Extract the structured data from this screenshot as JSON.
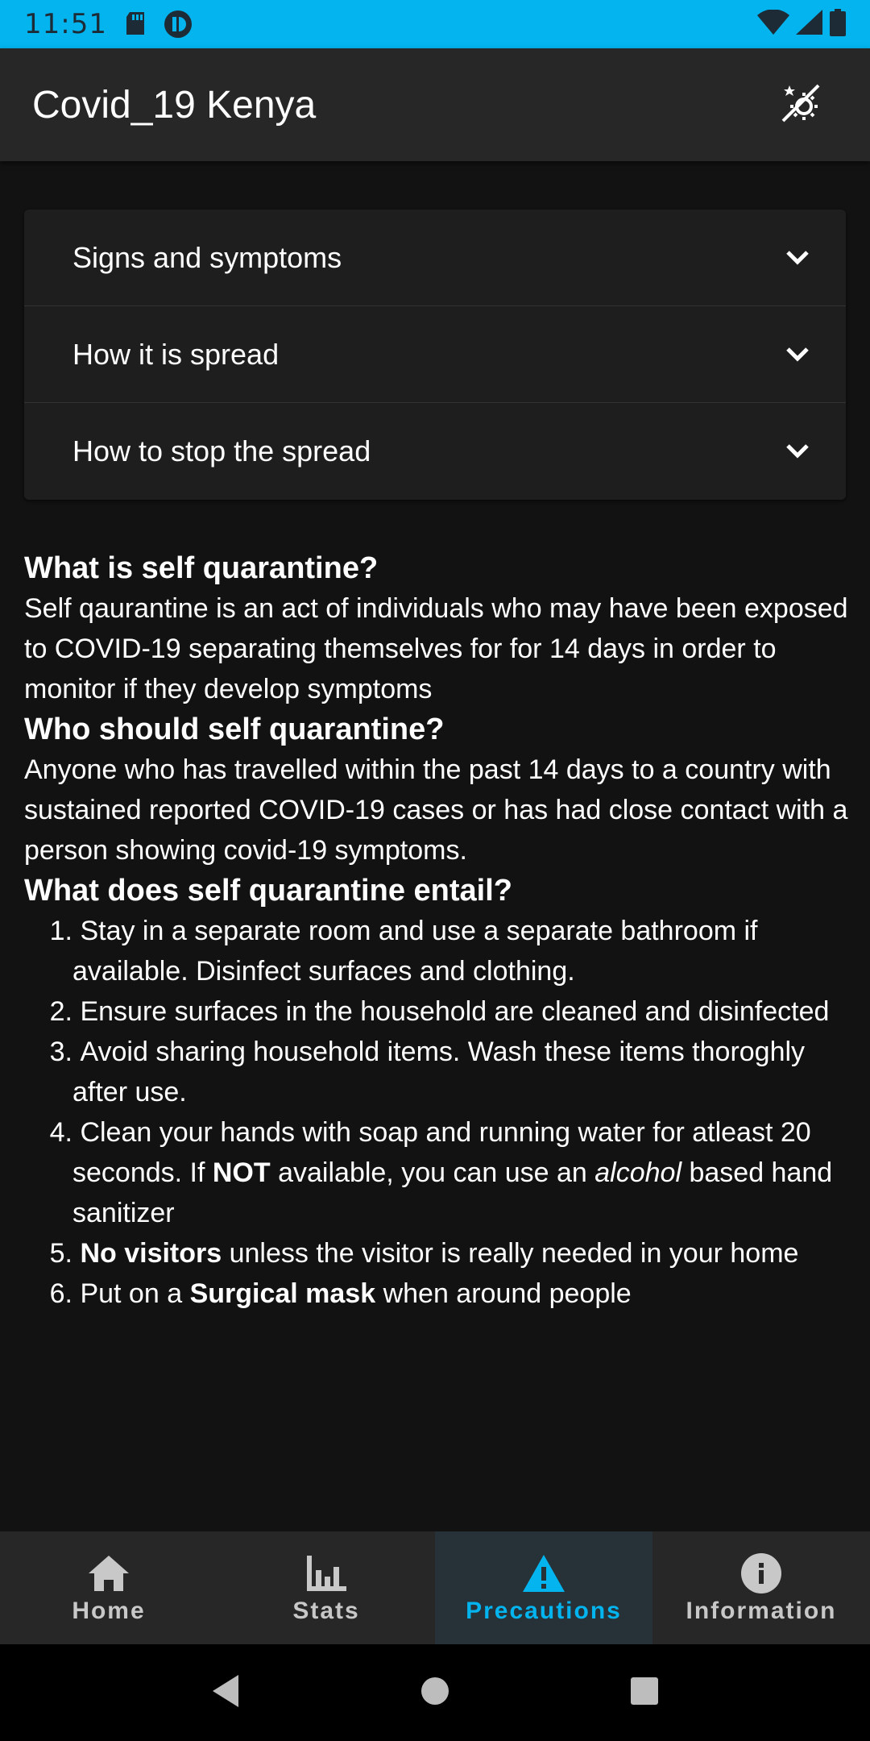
{
  "status_bar": {
    "time": "11:51",
    "icons": [
      "sd-card-icon",
      "app-notification-icon",
      "wifi-icon",
      "signal-icon",
      "battery-icon"
    ]
  },
  "app_bar": {
    "title": "Covid_19 Kenya",
    "theme_toggle_icon": "theme-toggle-icon"
  },
  "accordion": [
    {
      "label": "Signs and symptoms"
    },
    {
      "label": "How it is spread"
    },
    {
      "label": "How to stop the spread"
    }
  ],
  "content": {
    "q1": "What is self quarantine?",
    "a1": "Self qaurantine is an act of individuals who may have been exposed to COVID-19 separating themselves for for 14 days in order to monitor if they develop symptoms",
    "q2": "Who should self quarantine?",
    "a2": "Anyone who has travelled within the past 14 days to a country with sustained reported COVID-19 cases or has had close contact with a person showing covid-19 symptoms.",
    "q3": "What does self quarantine entail?",
    "list": [
      {
        "num": "1.",
        "text": "Stay in a separate room and use a separate bathroom if available. Disinfect surfaces and clothing."
      },
      {
        "num": "2.",
        "text": "Ensure surfaces in the household are cleaned and disinfected"
      },
      {
        "num": "3.",
        "text": "Avoid sharing household items. Wash these items thoroghly after use."
      },
      {
        "num": "4.",
        "pre": "Clean your hands with soap and running water for atleast 20 seconds. If ",
        "bold": "NOT",
        "mid": " available, you can use an ",
        "italic": "alcohol",
        "post": " based hand sanitizer"
      },
      {
        "num": "5.",
        "bold": "No visitors",
        "post": " unless the visitor is really needed in your home"
      },
      {
        "num": "6.",
        "pre": "Put on a ",
        "bold": "Surgical mask",
        "post": " when around people"
      }
    ]
  },
  "bottom_nav": [
    {
      "label": "Home",
      "icon": "home-icon"
    },
    {
      "label": "Stats",
      "icon": "stats-icon"
    },
    {
      "label": "Precautions",
      "icon": "warning-icon",
      "active": true
    },
    {
      "label": "Information",
      "icon": "info-icon"
    }
  ],
  "colors": {
    "status_bar": "#03b4ee",
    "app_bar": "#272727",
    "background": "#121212",
    "accent": "#03b4ee"
  }
}
